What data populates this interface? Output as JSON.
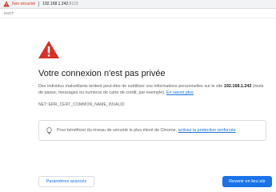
{
  "addressbar": {
    "not_secure_label": "Non sécurisé",
    "url_host": "192.168.1.242",
    "url_port": ":8123"
  },
  "subbar": {
    "label": "HACT"
  },
  "main": {
    "title": "Votre connexion n'est pas privée",
    "para_before": "Des individus malveillants tentent peut-être de subtiliser vos informations personnelles sur le site ",
    "para_host": "192.168.1.242",
    "para_after": " (mots de passe, messages ou numéros de carte de crédit, par exemple). ",
    "learn_more": "En savoir plus",
    "error_code": "NET::ERR_CERT_COMMON_NAME_INVALID"
  },
  "protection": {
    "text_before": "Pour bénéficier du niveau de sécurité le plus élevé de Chrome, ",
    "link_text": "activez la protection renforcée"
  },
  "buttons": {
    "advanced": "Paramètres avancés",
    "back": "Revenir en lieu sûr"
  },
  "colors": {
    "warning_red": "#d93025",
    "link_blue": "#1a73e8",
    "primary_button": "#1a73e8"
  },
  "icons": {
    "address_warning": "warning-triangle-icon",
    "main_warning": "warning-triangle-icon",
    "protection": "lightbulb-icon"
  }
}
